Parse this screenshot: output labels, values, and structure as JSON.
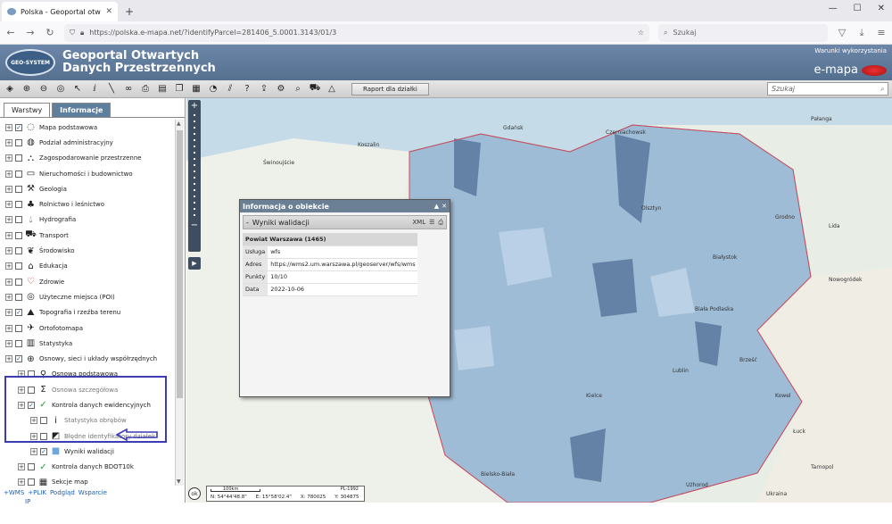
{
  "browser": {
    "tab_title": "Polska - Geoportal otwartych d",
    "tab_close": "✕",
    "new_tab": "+",
    "url": "https://polska.e-mapa.net/?identifyParcel=281406_5.0001.3143/01/3",
    "search_placeholder": "Szukaj",
    "win_min": "—",
    "win_max": "☐",
    "win_close": "✕"
  },
  "header": {
    "logo_text": "GEO-SYSTEM",
    "title_line1": "Geoportal Otwartych",
    "title_line2": "Danych Przestrzennych",
    "terms_link": "Warunki wykorzystania",
    "brand": "e-mapa"
  },
  "toolbar": {
    "report_button": "Raport dla działki",
    "search_placeholder": "Szukaj"
  },
  "panel": {
    "tabs": [
      {
        "label": "Warstwy",
        "active": true
      },
      {
        "label": "Informacje",
        "active": false
      }
    ],
    "layers": [
      {
        "label": "Mapa podstawowa",
        "checked": true,
        "icon": "map-icon",
        "level": 0
      },
      {
        "label": "Podział administracyjny",
        "checked": false,
        "icon": "admin-division-icon",
        "level": 0
      },
      {
        "label": "Zagospodarowanie przestrzenne",
        "checked": false,
        "icon": "spatial-planning-icon",
        "level": 0
      },
      {
        "label": "Nieruchomości i budownictwo",
        "checked": false,
        "icon": "building-icon",
        "level": 0
      },
      {
        "label": "Geologia",
        "checked": false,
        "icon": "geology-icon",
        "level": 0
      },
      {
        "label": "Rolnictwo i leśnictwo",
        "checked": false,
        "icon": "agriculture-icon",
        "level": 0
      },
      {
        "label": "Hydrografia",
        "checked": false,
        "icon": "water-drop-icon",
        "level": 0
      },
      {
        "label": "Transport",
        "checked": false,
        "icon": "transport-icon",
        "level": 0
      },
      {
        "label": "Środowisko",
        "checked": false,
        "icon": "environment-icon",
        "level": 0
      },
      {
        "label": "Edukacja",
        "checked": false,
        "icon": "education-icon",
        "level": 0
      },
      {
        "label": "Zdrowie",
        "checked": false,
        "icon": "heart-icon",
        "level": 0
      },
      {
        "label": "Użyteczne miejsca (POI)",
        "checked": false,
        "icon": "poi-icon",
        "level": 0
      },
      {
        "label": "Topografia i rzeźba terenu",
        "checked": true,
        "icon": "topography-icon",
        "level": 0
      },
      {
        "label": "Ortofotomapa",
        "checked": false,
        "icon": "orthophoto-icon",
        "level": 0
      },
      {
        "label": "Statystyka",
        "checked": false,
        "icon": "statistics-icon",
        "level": 0
      },
      {
        "label": "Osnowy, sieci i układy współrzędnych",
        "checked": true,
        "icon": "globe-icon",
        "level": 0
      },
      {
        "label": "Osnowa podstawowa",
        "checked": false,
        "icon": "survey-point-icon",
        "level": 1
      },
      {
        "label": "Osnowa szczegółowa",
        "checked": false,
        "icon": "sigma-icon",
        "level": 1,
        "dim": true
      },
      {
        "label": "Kontrola danych ewidencyjnych",
        "checked": true,
        "icon": "check-icon",
        "level": 1
      },
      {
        "label": "Statystyka obrębów",
        "checked": false,
        "icon": "info-icon",
        "level": 2,
        "dim": true
      },
      {
        "label": "Błędne identyfikatory działek",
        "checked": false,
        "icon": "error-parcel-icon",
        "level": 2,
        "dim": true
      },
      {
        "label": "Wyniki walidacji",
        "checked": true,
        "icon": "validation-square-icon",
        "level": 2
      },
      {
        "label": "Kontrola danych BDOT10k",
        "checked": false,
        "icon": "check-icon",
        "level": 1
      },
      {
        "label": "Sekcje map",
        "checked": false,
        "icon": "grid-icon",
        "level": 1
      }
    ],
    "footer_links": [
      "+WMS",
      "+PLIK",
      "Podgląd",
      "Wsparcie"
    ],
    "ip_link": "IP"
  },
  "info_window": {
    "title": "Informacja o obiekcie",
    "section_title": "Wyniki walidacji",
    "table_header": "Powiat Warszawa (1465)",
    "rows": [
      {
        "key": "Usługa",
        "value": "wfs"
      },
      {
        "key": "Adres",
        "value": "https://wms2.um.warszawa.pl/geoserver/wfs/wms"
      },
      {
        "key": "Punkty",
        "value": "10/10"
      },
      {
        "key": "Data",
        "value": "2022-10-06"
      }
    ]
  },
  "map": {
    "labels": [
      "Koszalin",
      "Świnoujście",
      "Gdańsk",
      "Olsztyn",
      "Białystok",
      "Biała Podlaska",
      "Lublin",
      "Kielce",
      "Bielsko-Biała",
      "Ukraina",
      "Pałanga",
      "Czerniachowsk",
      "Grodno",
      "Lida",
      "Brześć",
      "Kowel",
      "Łuck",
      "Tarnopol",
      "Użhorod",
      "Nowogródek"
    ],
    "status": {
      "ok": "ok",
      "scale": "100km",
      "projection": "PL-1992",
      "n": "N: 54°44'48.8\"",
      "e": "E: 15°58'02.4\"",
      "x": "X: 780025",
      "y": "Y: 304875"
    }
  }
}
